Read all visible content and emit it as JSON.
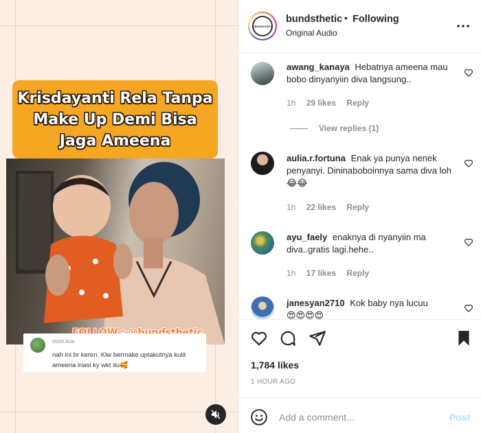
{
  "post": {
    "overlay_title": "Krisdayanti Rela Tanpa Make Up Demi Bisa Jaga Ameena",
    "watermark": "FOLLOW : @bundsthetic",
    "embedded_comment": {
      "username": "mom.kus",
      "text": "nah ini br keren. Klw bermake uptakutnya kulit ameena iriasi ky wkt itu🥰"
    },
    "mute_icon": "speaker-muted-icon"
  },
  "header": {
    "avatar_text": "@BUNDSTHETIC",
    "username": "bundsthetic",
    "separator": "•",
    "follow_status": "Following",
    "audio": "Original Audio",
    "more_icon": "more-horizontal-icon"
  },
  "comments": [
    {
      "username": "awang_kanaya",
      "text": "Hebatnya ameena mau bobo dinyanyiin diva langsung..",
      "time": "1h",
      "likes": "29 likes",
      "reply": "Reply",
      "avatar_color": "#6c7a78"
    },
    {
      "username": "aulia.r.fortuna",
      "text": "Enak ya punya nenek penyanyi. Dininaboboinnya sama diva loh 😂😂",
      "time": "1h",
      "likes": "22 likes",
      "reply": "Reply",
      "avatar_color": "#2b2b2b"
    },
    {
      "username": "ayu_faely",
      "text": "enaknya di nyanyiin ma diva..gratis lagi.hehe..",
      "time": "1h",
      "likes": "17 likes",
      "reply": "Reply",
      "avatar_color": "#4a8a5c"
    },
    {
      "username": "janesyan2710",
      "text": "Kok baby nya lucuu",
      "emoji_line": "😍😍😍😍",
      "avatar_color": "#3f6fb0"
    }
  ],
  "view_replies": "View replies (1)",
  "actions": {
    "icons": [
      "heart-icon",
      "comment-icon",
      "share-icon",
      "bookmark-icon"
    ],
    "likes": "1,784 likes",
    "time_ago": "1 HOUR AGO"
  },
  "add_comment": {
    "placeholder": "Add a comment...",
    "post_label": "Post",
    "emoji_icon": "emoji-icon"
  }
}
